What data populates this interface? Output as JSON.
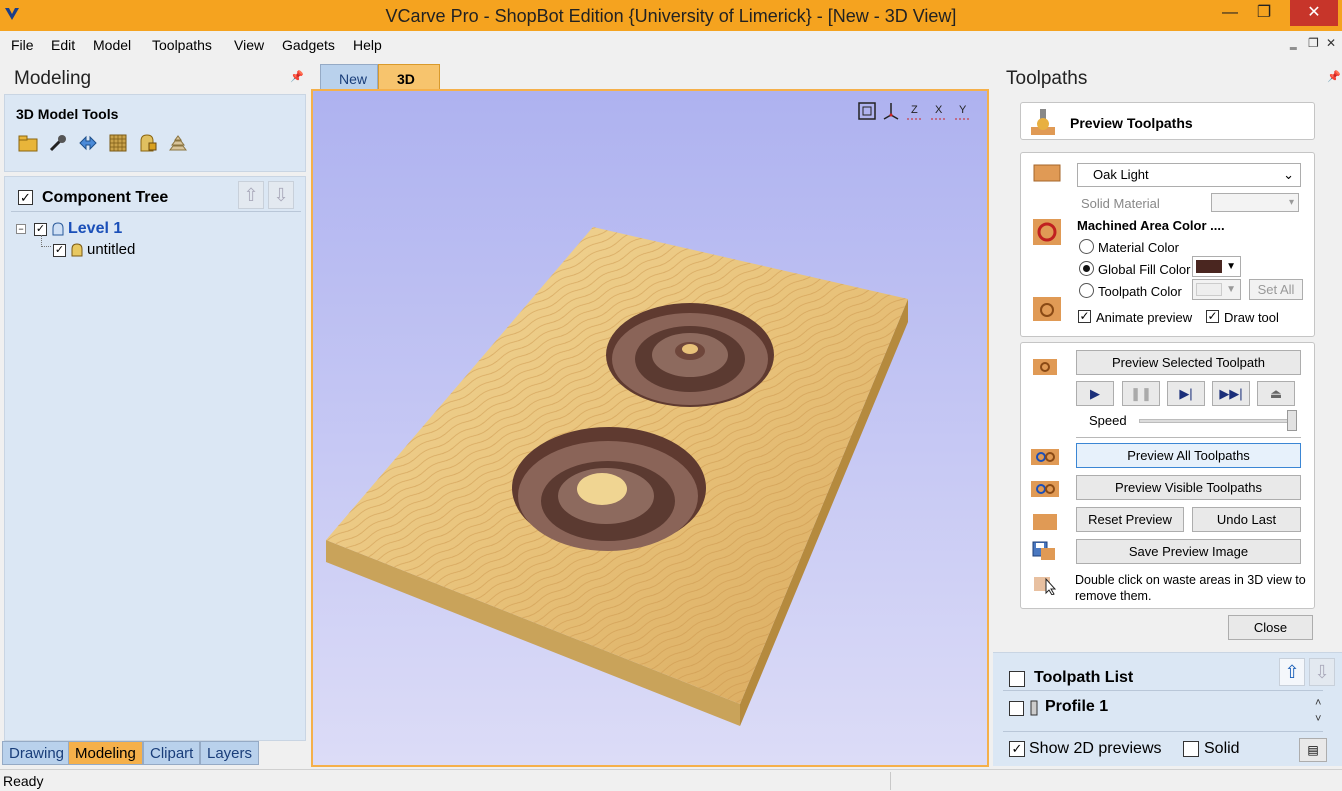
{
  "window": {
    "title": "VCarve Pro - ShopBot Edition {University of Limerick} - [New - 3D View]"
  },
  "menu": [
    "File",
    "Edit",
    "Model",
    "Toolpaths",
    "View",
    "Gadgets",
    "Help"
  ],
  "left_panel": {
    "title": "Modeling",
    "tools_label": "3D Model Tools",
    "tree": {
      "title": "Component Tree",
      "level": "Level 1",
      "child": "untitled"
    },
    "bottom_tabs": [
      "Drawing",
      "Modeling",
      "Clipart",
      "Layers"
    ]
  },
  "doc_tabs": [
    "New",
    "3D View"
  ],
  "right_panel": {
    "title": "Toolpaths",
    "header": "Preview Toolpaths",
    "material": {
      "selected": "Oak Light",
      "solid_material_label": "Solid Material"
    },
    "machined_area": {
      "label": "Machined Area Color ....",
      "options": [
        "Material Color",
        "Global Fill Color",
        "Toolpath Color"
      ],
      "selected": "Global Fill Color",
      "global_fill_color": "#4a2620",
      "set_all": "Set All"
    },
    "animate_preview": "Animate preview",
    "draw_tool": "Draw tool",
    "preview_selected": "Preview Selected Toolpath",
    "speed_label": "Speed",
    "speed_fraction": 1.0,
    "preview_all": "Preview All Toolpaths",
    "preview_visible": "Preview Visible Toolpaths",
    "reset_preview": "Reset Preview",
    "undo_last": "Undo Last",
    "save_preview_image": "Save Preview Image",
    "hint": "Double click on waste areas in 3D view to remove them.",
    "close": "Close",
    "toolpath_list": {
      "title": "Toolpath List",
      "items": [
        "Profile 1"
      ],
      "show_2d_previews": "Show 2D previews",
      "solid": "Solid"
    }
  },
  "status": {
    "text": "Ready"
  }
}
